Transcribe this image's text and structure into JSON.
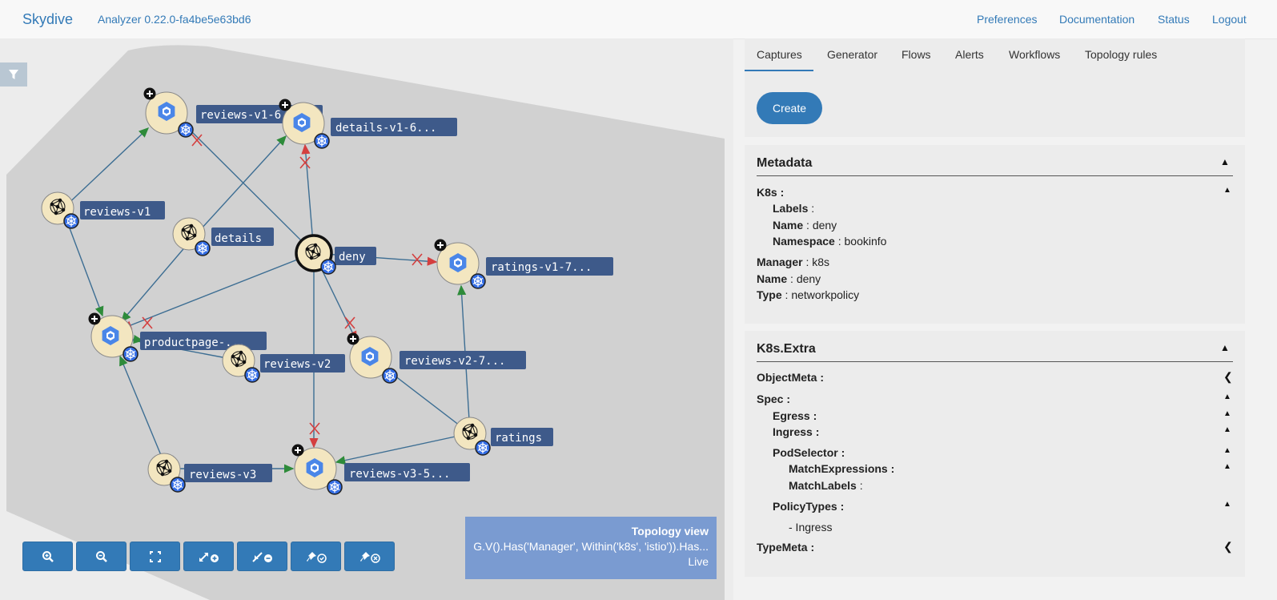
{
  "navbar": {
    "brand": "Skydive",
    "version": "Analyzer 0.22.0-fa4be5e63bd6",
    "links": [
      "Preferences",
      "Documentation",
      "Status",
      "Logout"
    ]
  },
  "graph": {
    "nodes": [
      {
        "label": "reviews-v1-6...",
        "kind": "pod-k8s"
      },
      {
        "label": "details-v1-6...",
        "kind": "pod-k8s"
      },
      {
        "label": "reviews-v1",
        "kind": "deployment"
      },
      {
        "label": "details",
        "kind": "deployment"
      },
      {
        "label": "deny",
        "kind": "networkpolicy"
      },
      {
        "label": "ratings-v1-7...",
        "kind": "pod-k8s"
      },
      {
        "label": "productpage-...",
        "kind": "pod-k8s"
      },
      {
        "label": "reviews-v2",
        "kind": "deployment"
      },
      {
        "label": "reviews-v2-7...",
        "kind": "pod-k8s"
      },
      {
        "label": "ratings",
        "kind": "deployment"
      },
      {
        "label": "reviews-v3",
        "kind": "deployment"
      },
      {
        "label": "reviews-v3-5...",
        "kind": "pod-k8s"
      }
    ],
    "accent": "#337ab7",
    "label_bg": "#3e5a8a",
    "node_fill": "#f3e6c0"
  },
  "toolbar": {
    "buttons": [
      "zoom-in-icon",
      "zoom-out-icon",
      "fit-icon",
      "expand-icon",
      "collapse-icon",
      "pin-icon",
      "unpin-icon"
    ]
  },
  "topology_view": {
    "title": "Topology view",
    "query": "G.V().Has('Manager', Within('k8s', 'istio')).Has...",
    "status": "Live"
  },
  "tabs": [
    "Captures",
    "Generator",
    "Flows",
    "Alerts",
    "Workflows",
    "Topology rules"
  ],
  "captures": {
    "create_label": "Create"
  },
  "metadata": {
    "title": "Metadata",
    "k8s_key": "K8s",
    "labels_key": "Labels",
    "name_key": "Name",
    "name_val": "deny",
    "namespace_key": "Namespace",
    "namespace_val": "bookinfo",
    "manager_key": "Manager",
    "manager_val": "k8s",
    "name2_key": "Name",
    "name2_val": "deny",
    "type_key": "Type",
    "type_val": "networkpolicy"
  },
  "extra": {
    "title": "K8s.Extra",
    "objectmeta": "ObjectMeta",
    "spec": "Spec",
    "egress": "Egress",
    "ingress": "Ingress",
    "podselector": "PodSelector",
    "matchexpressions": "MatchExpressions",
    "matchlabels": "MatchLabels",
    "policytypes": "PolicyTypes",
    "policytype_item": "- Ingress",
    "typemeta": "TypeMeta"
  }
}
